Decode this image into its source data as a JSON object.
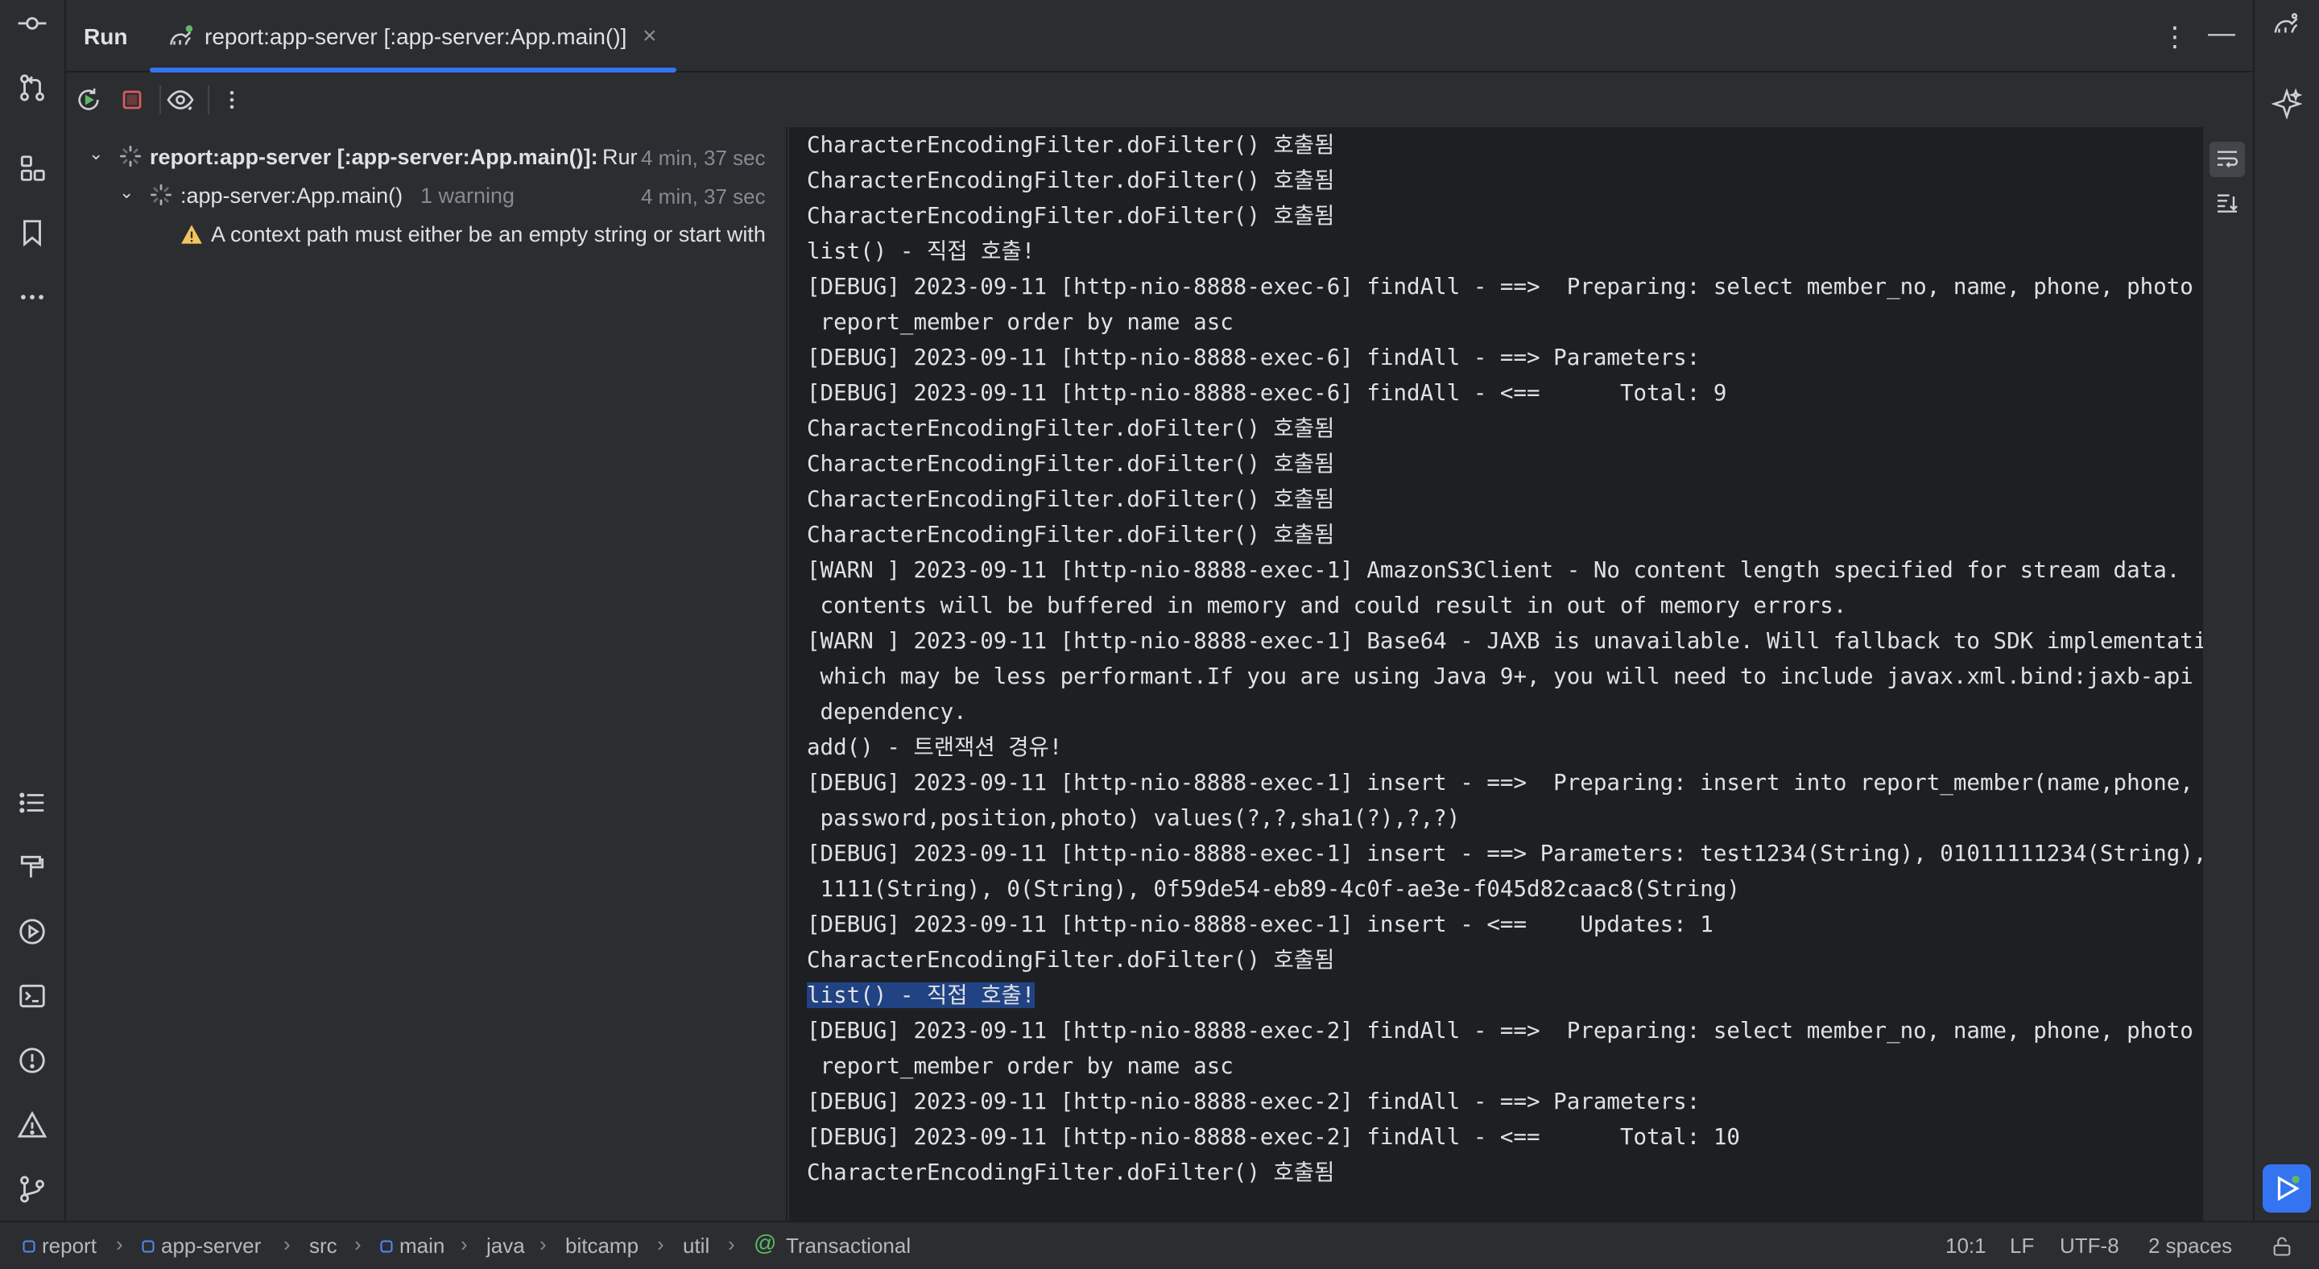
{
  "header": {
    "run_label": "Run",
    "tab_label": "report:app-server [:app-server:App.main()]",
    "close_glyph": "×",
    "more_glyph": "⋮",
    "minimize_glyph": "—"
  },
  "tree": {
    "root": {
      "label": "report:app-server [:app-server:App.main()]:",
      "status": "Rur",
      "time": "4 min, 37 sec"
    },
    "child": {
      "label": ":app-server:App.main()",
      "note": "1 warning",
      "time": "4 min, 37 sec"
    },
    "warning": {
      "text": "A context path must either be an empty string or start with"
    }
  },
  "console": {
    "lines": [
      "CharacterEncodingFilter.doFilter() 호출됨",
      "CharacterEncodingFilter.doFilter() 호출됨",
      "CharacterEncodingFilter.doFilter() 호출됨",
      "list() - 직접 호출!",
      "[DEBUG] 2023-09-11 [http-nio-8888-exec-6] findAll - ==>  Preparing: select member_no, name, phone, photo from",
      " report_member order by name asc",
      "[DEBUG] 2023-09-11 [http-nio-8888-exec-6] findAll - ==> Parameters: ",
      "[DEBUG] 2023-09-11 [http-nio-8888-exec-6] findAll - <==      Total: 9",
      "CharacterEncodingFilter.doFilter() 호출됨",
      "CharacterEncodingFilter.doFilter() 호출됨",
      "CharacterEncodingFilter.doFilter() 호출됨",
      "CharacterEncodingFilter.doFilter() 호출됨",
      "[WARN ] 2023-09-11 [http-nio-8888-exec-1] AmazonS3Client - No content length specified for stream data.  Stream",
      " contents will be buffered in memory and could result in out of memory errors.",
      "[WARN ] 2023-09-11 [http-nio-8888-exec-1] Base64 - JAXB is unavailable. Will fallback to SDK implementation",
      " which may be less performant.If you are using Java 9+, you will need to include javax.xml.bind:jaxb-api as a",
      " dependency.",
      "add() - 트랜잭션 경유!",
      "[DEBUG] 2023-09-11 [http-nio-8888-exec-1] insert - ==>  Preparing: insert into report_member(name,phone,",
      " password,position,photo) values(?,?,sha1(?),?,?)",
      "[DEBUG] 2023-09-11 [http-nio-8888-exec-1] insert - ==> Parameters: test1234(String), 01011111234(String),",
      " 1111(String), 0(String), 0f59de54-eb89-4c0f-ae3e-f045d82caac8(String)",
      "[DEBUG] 2023-09-11 [http-nio-8888-exec-1] insert - <==    Updates: 1",
      "CharacterEncodingFilter.doFilter() 호출됨",
      "list() - 직접 호출!",
      "[DEBUG] 2023-09-11 [http-nio-8888-exec-2] findAll - ==>  Preparing: select member_no, name, phone, photo from",
      " report_member order by name asc",
      "[DEBUG] 2023-09-11 [http-nio-8888-exec-2] findAll - ==> Parameters: ",
      "[DEBUG] 2023-09-11 [http-nio-8888-exec-2] findAll - <==      Total: 10",
      "CharacterEncodingFilter.doFilter() 호출됨"
    ],
    "selected_line_index": 24
  },
  "statusbar": {
    "breadcrumbs": [
      "report",
      "app-server",
      "src",
      "main",
      "java",
      "bitcamp",
      "util",
      "Transactional"
    ],
    "position": "10:1",
    "line_ending": "LF",
    "encoding": "UTF-8",
    "indent": "2 spaces"
  },
  "colors": {
    "accent": "#3574f0",
    "selection": "#214283",
    "warning": "#f2c55c",
    "stop": "#db5c5c",
    "rerun": "#5fb865"
  },
  "icons": {
    "left_strip": [
      "commit-icon",
      "pull-requests-icon",
      "structure-icon",
      "bookmarks-icon",
      "more-tools-icon",
      "todo-list-icon",
      "build-icon",
      "services-icon",
      "terminal-icon",
      "problems-icon",
      "warnings-icon",
      "git-icon"
    ],
    "right_strip": [
      "gradle-icon",
      "ai-assistant-icon"
    ],
    "toolbar": [
      "rerun-icon",
      "stop-icon",
      "view-icon",
      "more-icon"
    ],
    "console_gutter": [
      "soft-wrap-icon",
      "scroll-to-end-icon"
    ]
  }
}
